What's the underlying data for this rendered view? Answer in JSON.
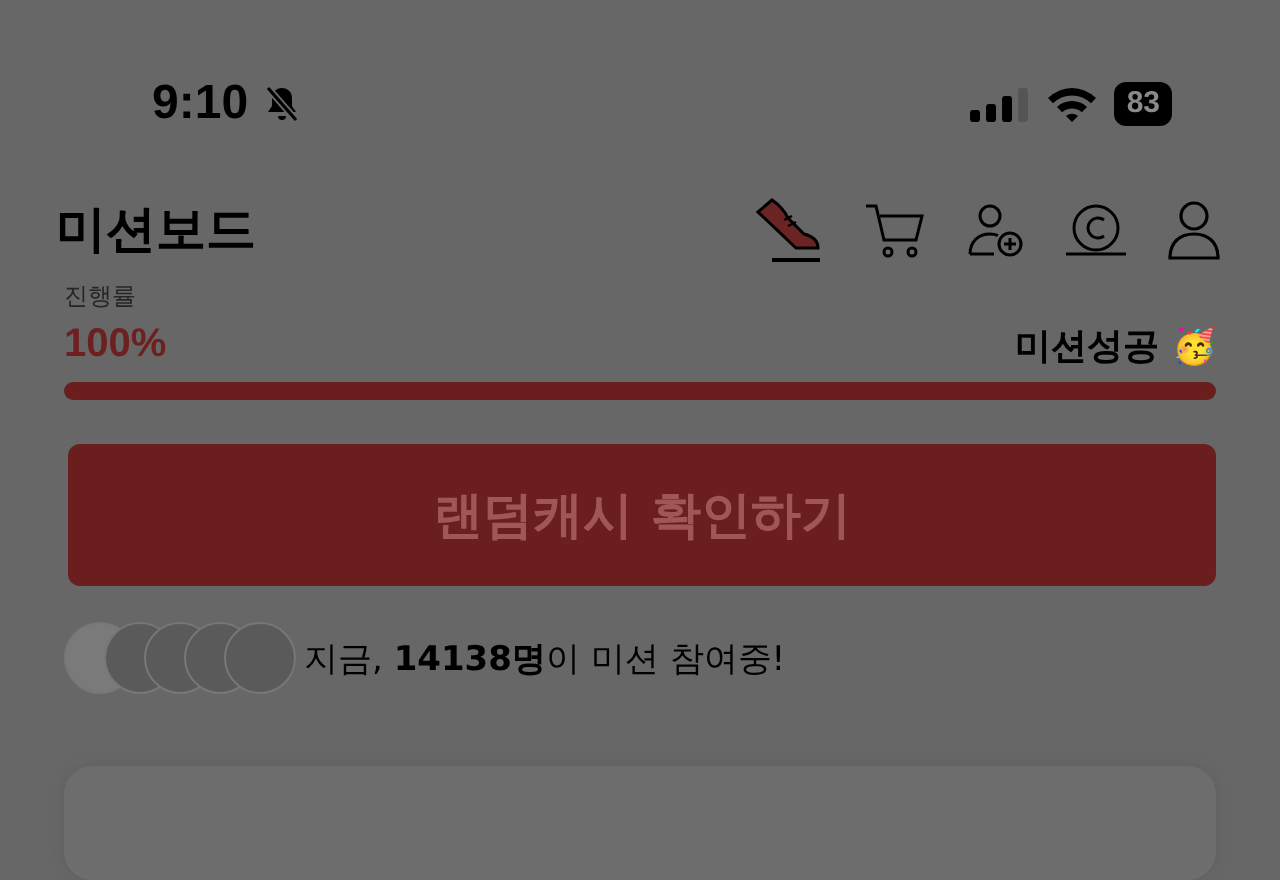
{
  "status_bar": {
    "time": "9:10",
    "battery": "83"
  },
  "header": {
    "title": "미션보드"
  },
  "progress": {
    "label": "진행률",
    "value": "100%",
    "status": "미션성공",
    "emoji": "🥳",
    "level": 1
  },
  "cta_button": {
    "label": "랜덤캐시 확인하기"
  },
  "participants": {
    "text": "지금, **14138명**이 미션 참여중!"
  }
}
